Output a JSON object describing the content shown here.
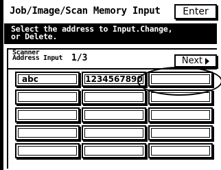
{
  "header": {
    "title": "Job/Image/Scan Memory Input",
    "enter_label": "Enter"
  },
  "instruction": {
    "text": "Select the address to Input.Change,\nor Delete."
  },
  "panel": {
    "tab_label": "Scanner\nAddress Input",
    "page_indicator": "1/3",
    "next_label": "Next",
    "next_icon": "triangle-right-icon"
  },
  "addresses": [
    {
      "label": "abc"
    },
    {
      "label": "1234567890"
    },
    {
      "label": ""
    },
    {
      "label": ""
    },
    {
      "label": ""
    },
    {
      "label": ""
    },
    {
      "label": ""
    },
    {
      "label": ""
    },
    {
      "label": ""
    },
    {
      "label": ""
    },
    {
      "label": ""
    },
    {
      "label": ""
    },
    {
      "label": ""
    },
    {
      "label": ""
    },
    {
      "label": ""
    }
  ],
  "colors": {
    "foreground": "#000000",
    "background": "#ffffff"
  }
}
